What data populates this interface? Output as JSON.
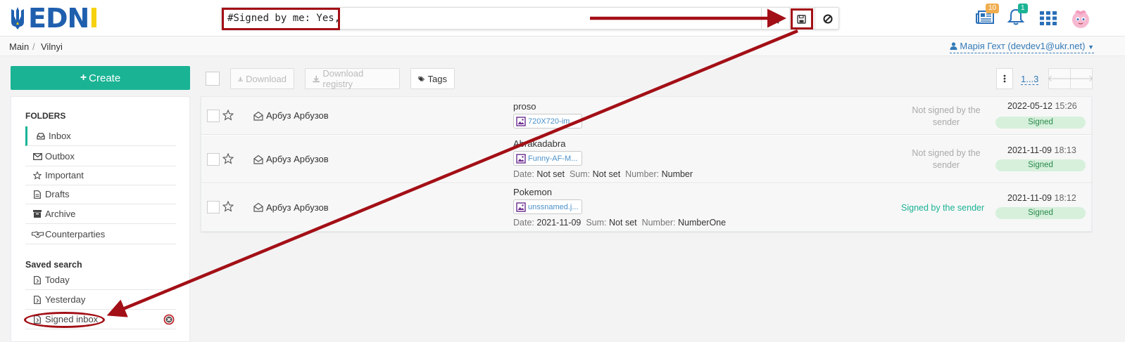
{
  "header": {
    "logo_text": "EDNI",
    "search_value": "#Signed by me: Yes,",
    "notifications": {
      "news_count": "10",
      "bell_count": "1"
    }
  },
  "breadcrumb": {
    "main": "Main",
    "current": "Vilnyi"
  },
  "user": {
    "label": "Марія Гехт (devdev1@ukr.net)"
  },
  "sidebar": {
    "create_label": "Create",
    "folders_heading": "FOLDERS",
    "folders": [
      {
        "label": "Inbox",
        "icon": "inbox-icon"
      },
      {
        "label": "Outbox",
        "icon": "envelope-icon"
      },
      {
        "label": "Important",
        "icon": "star-icon"
      },
      {
        "label": "Drafts",
        "icon": "file-icon"
      },
      {
        "label": "Archive",
        "icon": "archive-icon"
      },
      {
        "label": "Counterparties",
        "icon": "handshake-icon"
      }
    ],
    "saved_heading": "Saved search",
    "saved": [
      {
        "label": "Today",
        "icon": "saved-file-icon"
      },
      {
        "label": "Yesterday",
        "icon": "saved-file-icon"
      },
      {
        "label": "Signed inbox",
        "icon": "saved-file-icon"
      }
    ]
  },
  "toolbar": {
    "download_label": "Download",
    "download_registry_label": "Download registry",
    "tags_label": "Tags",
    "pager": "1...3"
  },
  "messages": [
    {
      "sender": "Арбуз Арбузов",
      "subject": "proso",
      "file": "720X720-im...",
      "meta": null,
      "signature_status": "Not signed by the sender",
      "date": "2022-05-12",
      "time": "15:26",
      "badge": "Signed"
    },
    {
      "sender": "Арбуз Арбузов",
      "subject": "Abrakadabra",
      "file": "Funny-AF-M...",
      "meta": {
        "date_label": "Date:",
        "date": "Not set",
        "sum_label": "Sum:",
        "sum": "Not set",
        "number_label": "Number:",
        "number": "Number"
      },
      "signature_status": "Not signed by the sender",
      "date": "2021-11-09",
      "time": "18:13",
      "badge": "Signed"
    },
    {
      "sender": "Арбуз Арбузов",
      "subject": "Pokemon",
      "file": "unssnamed.j...",
      "meta": {
        "date_label": "Date:",
        "date": "2021-11-09",
        "sum_label": "Sum:",
        "sum": "Not set",
        "number_label": "Number:",
        "number": "NumberOne"
      },
      "signature_status": "Signed by the sender",
      "date": "2021-11-09",
      "time": "18:12",
      "badge": "Signed"
    }
  ],
  "colors": {
    "accent": "#1ab394",
    "brand_blue": "#1f5fae",
    "brand_yellow": "#f6d10f",
    "annotation": "#a30f16"
  }
}
